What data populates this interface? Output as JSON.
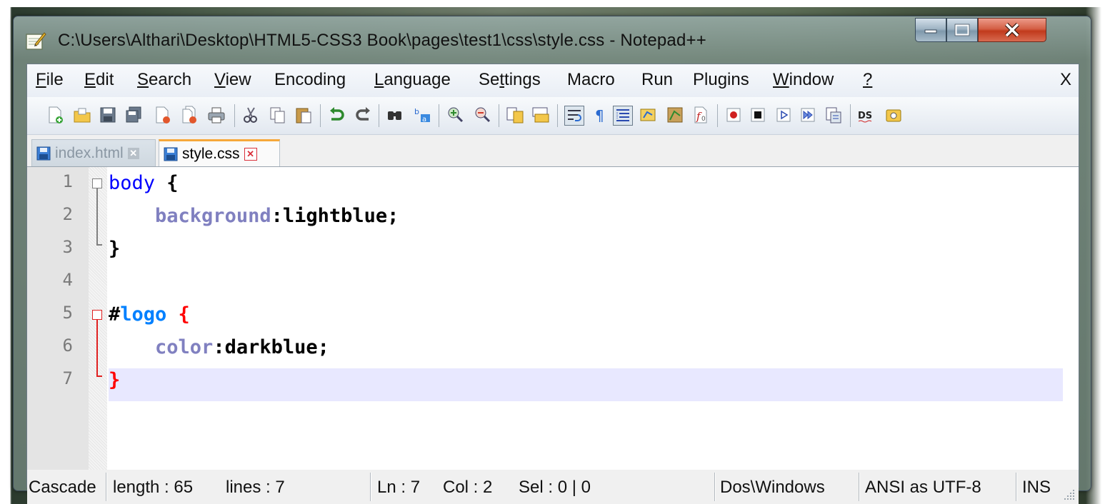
{
  "window": {
    "title": "C:\\Users\\Althari\\Desktop\\HTML5-CSS3 Book\\pages\\test1\\css\\style.css - Notepad++"
  },
  "menu": {
    "items": [
      "File",
      "Edit",
      "Search",
      "View",
      "Encoding",
      "Language",
      "Settings",
      "Macro",
      "Run",
      "Plugins",
      "Window",
      "?"
    ],
    "close": "X"
  },
  "toolbar": {
    "icons": [
      "new-file-icon",
      "open-file-icon",
      "save-icon",
      "save-all-icon",
      "close-icon",
      "close-all-icon",
      "print-icon",
      "cut-icon",
      "copy-icon",
      "paste-icon",
      "undo-icon",
      "redo-icon",
      "find-icon",
      "replace-icon",
      "zoom-in-icon",
      "zoom-out-icon",
      "sync-vertical-icon",
      "sync-horizontal-icon",
      "word-wrap-icon",
      "show-all-chars-icon",
      "indent-guide-icon",
      "user-lang-icon",
      "doc-map-icon",
      "function-list-icon",
      "record-macro-icon",
      "stop-record-icon",
      "play-macro-icon",
      "run-macro-multiple-icon",
      "save-macro-icon",
      "spell-check-icon",
      "compare-icon"
    ]
  },
  "tabs": [
    {
      "label": "index.html",
      "active": false
    },
    {
      "label": "style.css",
      "active": true
    }
  ],
  "editor": {
    "line_numbers": [
      "1",
      "2",
      "3",
      "4",
      "5",
      "6",
      "7"
    ],
    "current_line": "7",
    "lines": [
      [
        {
          "t": "body",
          "c": "#0000ff",
          "b": false
        },
        {
          "t": " {",
          "c": "#000000",
          "b": true
        }
      ],
      [
        {
          "t": "    ",
          "c": "#000000",
          "b": false
        },
        {
          "t": "background",
          "c": "#8080c0",
          "b": true
        },
        {
          "t": ":lightblue;",
          "c": "#000000",
          "b": true
        }
      ],
      [
        {
          "t": "}",
          "c": "#000000",
          "b": true
        }
      ],
      [],
      [
        {
          "t": "#",
          "c": "#000000",
          "b": true
        },
        {
          "t": "logo",
          "c": "#0080ff",
          "b": true
        },
        {
          "t": " {",
          "c": "#ff0000",
          "b": true
        }
      ],
      [
        {
          "t": "    ",
          "c": "#000000",
          "b": false
        },
        {
          "t": "color",
          "c": "#8080c0",
          "b": true
        },
        {
          "t": ":darkblue;",
          "c": "#000000",
          "b": true
        }
      ],
      [
        {
          "t": "}",
          "c": "#ff0000",
          "b": true
        }
      ]
    ]
  },
  "status": {
    "lexer": "Cascade",
    "length": "length : 65",
    "lines": "lines : 7",
    "ln": "Ln : 7",
    "col": "Col : 2",
    "sel": "Sel : 0 | 0",
    "eol": "Dos\\Windows",
    "encoding": "ANSI as UTF-8",
    "mode": "INS"
  },
  "colors": {
    "accent_tab": "#f6a83a",
    "current_line_bg": "#e8e8ff",
    "brace_highlight": "#ff0000"
  }
}
